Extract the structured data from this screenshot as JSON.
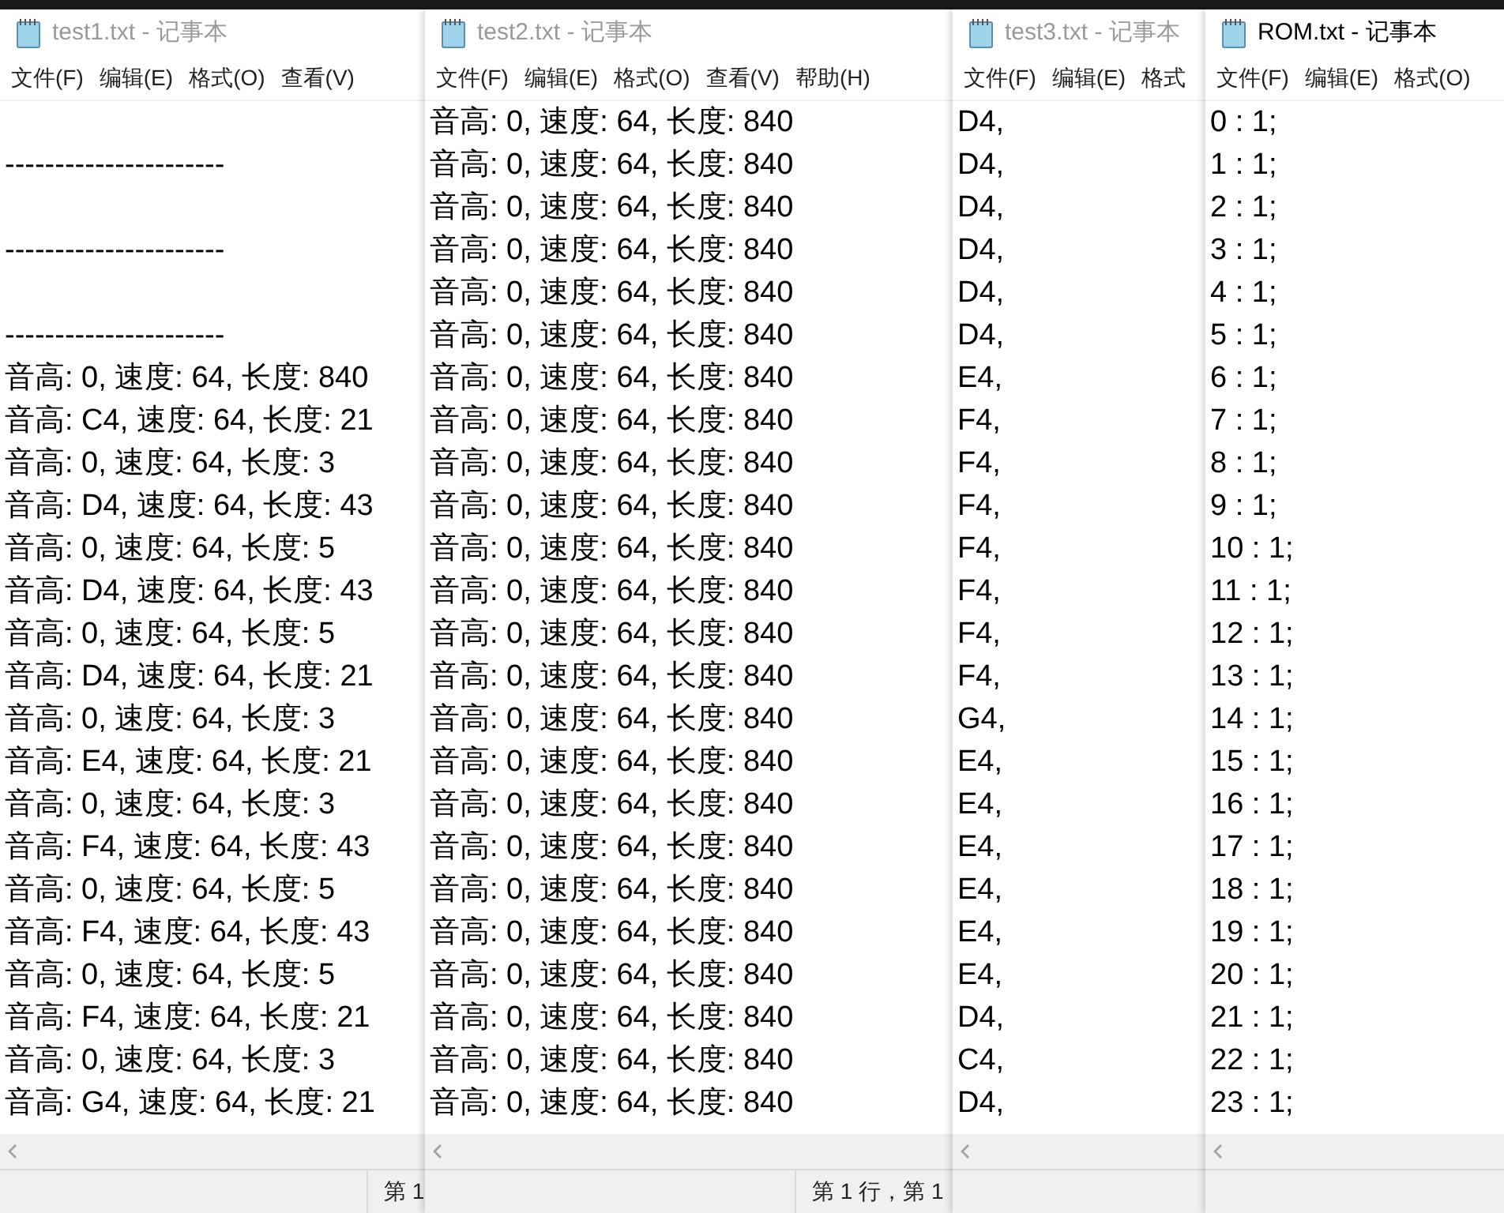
{
  "windows": [
    {
      "title": "test1.txt - 记事本",
      "active": false,
      "menu": [
        "文件(F)",
        "编辑(E)",
        "格式(O)",
        "查看(V)"
      ],
      "lines": [
        {
          "kind": "blank"
        },
        {
          "kind": "text",
          "text": "----------------------"
        },
        {
          "kind": "blank"
        },
        {
          "kind": "text",
          "text": "----------------------"
        },
        {
          "kind": "blank"
        },
        {
          "kind": "text",
          "text": "----------------------"
        },
        {
          "kind": "text",
          "text": "音高: 0, 速度: 64, 长度: 840"
        },
        {
          "kind": "text",
          "text": "音高: C4, 速度: 64, 长度: 21"
        },
        {
          "kind": "text",
          "text": "音高: 0, 速度: 64, 长度: 3"
        },
        {
          "kind": "text",
          "text": "音高: D4, 速度: 64, 长度: 43"
        },
        {
          "kind": "text",
          "text": "音高: 0, 速度: 64, 长度: 5"
        },
        {
          "kind": "text",
          "text": "音高: D4, 速度: 64, 长度: 43"
        },
        {
          "kind": "text",
          "text": "音高: 0, 速度: 64, 长度: 5"
        },
        {
          "kind": "text",
          "text": "音高: D4, 速度: 64, 长度: 21"
        },
        {
          "kind": "text",
          "text": "音高: 0, 速度: 64, 长度: 3"
        },
        {
          "kind": "text",
          "text": "音高: E4, 速度: 64, 长度: 21"
        },
        {
          "kind": "text",
          "text": "音高: 0, 速度: 64, 长度: 3"
        },
        {
          "kind": "text",
          "text": "音高: F4, 速度: 64, 长度: 43"
        },
        {
          "kind": "text",
          "text": "音高: 0, 速度: 64, 长度: 5"
        },
        {
          "kind": "text",
          "text": "音高: F4, 速度: 64, 长度: 43"
        },
        {
          "kind": "text",
          "text": "音高: 0, 速度: 64, 长度: 5"
        },
        {
          "kind": "text",
          "text": "音高: F4, 速度: 64, 长度: 21"
        },
        {
          "kind": "text",
          "text": "音高: 0, 速度: 64, 长度: 3"
        },
        {
          "kind": "text",
          "text": "音高: G4, 速度: 64, 长度: 21"
        }
      ],
      "status": "第 1"
    },
    {
      "title": "test2.txt - 记事本",
      "active": false,
      "menu": [
        "文件(F)",
        "编辑(E)",
        "格式(O)",
        "查看(V)",
        "帮助(H)"
      ],
      "lines": [
        {
          "kind": "text",
          "text": "音高: 0, 速度: 64, 长度: 840"
        },
        {
          "kind": "text",
          "text": "音高: 0, 速度: 64, 长度: 840"
        },
        {
          "kind": "text",
          "text": "音高: 0, 速度: 64, 长度: 840"
        },
        {
          "kind": "text",
          "text": "音高: 0, 速度: 64, 长度: 840"
        },
        {
          "kind": "text",
          "text": "音高: 0, 速度: 64, 长度: 840"
        },
        {
          "kind": "text",
          "text": "音高: 0, 速度: 64, 长度: 840"
        },
        {
          "kind": "text",
          "text": "音高: 0, 速度: 64, 长度: 840"
        },
        {
          "kind": "text",
          "text": "音高: 0, 速度: 64, 长度: 840"
        },
        {
          "kind": "text",
          "text": "音高: 0, 速度: 64, 长度: 840"
        },
        {
          "kind": "text",
          "text": "音高: 0, 速度: 64, 长度: 840"
        },
        {
          "kind": "text",
          "text": "音高: 0, 速度: 64, 长度: 840"
        },
        {
          "kind": "text",
          "text": "音高: 0, 速度: 64, 长度: 840"
        },
        {
          "kind": "text",
          "text": "音高: 0, 速度: 64, 长度: 840"
        },
        {
          "kind": "text",
          "text": "音高: 0, 速度: 64, 长度: 840"
        },
        {
          "kind": "text",
          "text": "音高: 0, 速度: 64, 长度: 840"
        },
        {
          "kind": "text",
          "text": "音高: 0, 速度: 64, 长度: 840"
        },
        {
          "kind": "text",
          "text": "音高: 0, 速度: 64, 长度: 840"
        },
        {
          "kind": "text",
          "text": "音高: 0, 速度: 64, 长度: 840"
        },
        {
          "kind": "text",
          "text": "音高: 0, 速度: 64, 长度: 840"
        },
        {
          "kind": "text",
          "text": "音高: 0, 速度: 64, 长度: 840"
        },
        {
          "kind": "text",
          "text": "音高: 0, 速度: 64, 长度: 840"
        },
        {
          "kind": "text",
          "text": "音高: 0, 速度: 64, 长度: 840"
        },
        {
          "kind": "text",
          "text": "音高: 0, 速度: 64, 长度: 840"
        },
        {
          "kind": "text",
          "text": "音高: 0, 速度: 64, 长度: 840"
        }
      ],
      "status": "第 1 行，第 1"
    },
    {
      "title": "test3.txt - 记事本",
      "active": false,
      "menu": [
        "文件(F)",
        "编辑(E)",
        "格式"
      ],
      "lines": [
        {
          "kind": "text",
          "text": "D4,"
        },
        {
          "kind": "text",
          "text": "D4,"
        },
        {
          "kind": "text",
          "text": "D4,"
        },
        {
          "kind": "text",
          "text": "D4,"
        },
        {
          "kind": "text",
          "text": "D4,"
        },
        {
          "kind": "text",
          "text": "D4,"
        },
        {
          "kind": "text",
          "text": "E4,"
        },
        {
          "kind": "text",
          "text": "F4,"
        },
        {
          "kind": "text",
          "text": "F4,"
        },
        {
          "kind": "text",
          "text": "F4,"
        },
        {
          "kind": "text",
          "text": "F4,"
        },
        {
          "kind": "text",
          "text": "F4,"
        },
        {
          "kind": "text",
          "text": "F4,"
        },
        {
          "kind": "text",
          "text": "F4,"
        },
        {
          "kind": "text",
          "text": "G4,"
        },
        {
          "kind": "text",
          "text": "E4,"
        },
        {
          "kind": "text",
          "text": "E4,"
        },
        {
          "kind": "text",
          "text": "E4,"
        },
        {
          "kind": "text",
          "text": "E4,"
        },
        {
          "kind": "text",
          "text": "E4,"
        },
        {
          "kind": "text",
          "text": "E4,"
        },
        {
          "kind": "text",
          "text": "D4,"
        },
        {
          "kind": "text",
          "text": "C4,"
        },
        {
          "kind": "text",
          "text": "D4,"
        }
      ]
    },
    {
      "title": "ROM.txt - 记事本",
      "active": true,
      "menu": [
        "文件(F)",
        "编辑(E)",
        "格式(O)"
      ],
      "lines": [
        {
          "kind": "text",
          "text": "0 : 1;"
        },
        {
          "kind": "text",
          "text": "1 : 1;"
        },
        {
          "kind": "text",
          "text": "2 : 1;"
        },
        {
          "kind": "text",
          "text": "3 : 1;"
        },
        {
          "kind": "text",
          "text": "4 : 1;"
        },
        {
          "kind": "text",
          "text": "5 : 1;"
        },
        {
          "kind": "text",
          "text": "6 : 1;"
        },
        {
          "kind": "text",
          "text": "7 : 1;"
        },
        {
          "kind": "text",
          "text": "8 : 1;"
        },
        {
          "kind": "text",
          "text": "9 : 1;"
        },
        {
          "kind": "text",
          "text": "10 : 1;"
        },
        {
          "kind": "text",
          "text": "11 : 1;"
        },
        {
          "kind": "text",
          "text": "12 : 1;"
        },
        {
          "kind": "text",
          "text": "13 : 1;"
        },
        {
          "kind": "text",
          "text": "14 : 1;"
        },
        {
          "kind": "text",
          "text": "15 : 1;"
        },
        {
          "kind": "text",
          "text": "16 : 1;"
        },
        {
          "kind": "text",
          "text": "17 : 1;"
        },
        {
          "kind": "text",
          "text": "18 : 1;"
        },
        {
          "kind": "text",
          "text": "19 : 1;"
        },
        {
          "kind": "text",
          "text": "20 : 1;"
        },
        {
          "kind": "text",
          "text": "21 : 1;"
        },
        {
          "kind": "text",
          "text": "22 : 1;"
        },
        {
          "kind": "text",
          "text": "23 : 1;"
        }
      ]
    }
  ]
}
